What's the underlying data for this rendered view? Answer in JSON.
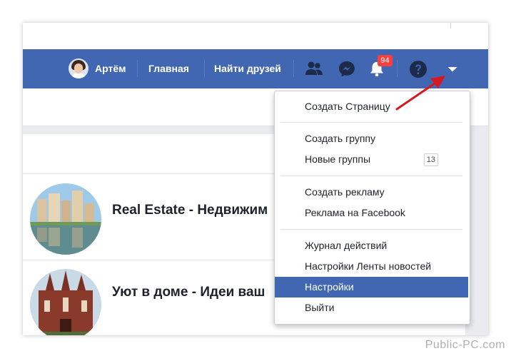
{
  "navbar": {
    "profile_name": "Артём",
    "links": [
      "Главная",
      "Найти друзей"
    ],
    "notifications_count": "94",
    "icons": [
      "friend-requests-icon",
      "messenger-icon",
      "notifications-bell-icon",
      "help-icon",
      "account-menu-caret-icon"
    ]
  },
  "groups": [
    {
      "title": "Real Estate - Недвижим"
    },
    {
      "title": "Уют в доме - Идеи ваш"
    }
  ],
  "dropdown": {
    "items": [
      "Создать Страницу",
      "Создать группу",
      "Новые группы",
      "Создать рекламу",
      "Реклама на Facebook",
      "Журнал действий",
      "Настройки Ленты новостей",
      "Настройки",
      "Выйти"
    ],
    "new_groups_count": "13",
    "highlighted_item": "Настройки"
  },
  "watermark": "Public-PC.com",
  "colors": {
    "navbar": "#4267b2",
    "badge": "#fa3e3e",
    "highlight": "#4267b2",
    "annotation_arrow": "#d7181f"
  }
}
